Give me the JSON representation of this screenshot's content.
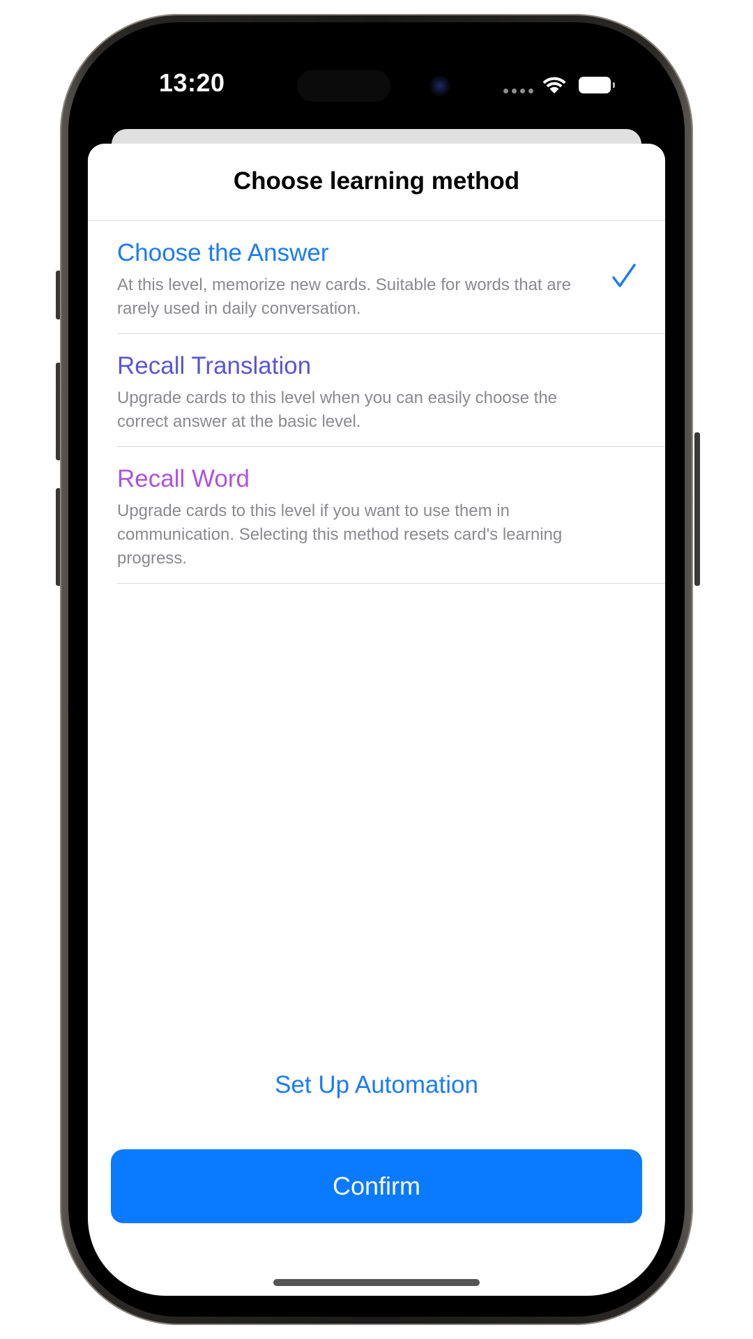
{
  "status_bar": {
    "time": "13:20",
    "icons": [
      "signal-dots-icon",
      "wifi-icon",
      "battery-icon"
    ]
  },
  "sheet": {
    "title": "Choose learning method"
  },
  "options": [
    {
      "title": "Choose the Answer",
      "description": "At this level, memorize new cards. Suitable for words that are rarely used in daily conversation.",
      "color": "#1a7cf5",
      "selected": true
    },
    {
      "title": "Recall Translation",
      "description": "Upgrade cards to this level when you can easily choose the correct answer at the basic level.",
      "color": "#5856d6",
      "selected": false
    },
    {
      "title": "Recall Word",
      "description": "Upgrade cards to this level if you want to use them in communication. Selecting this method resets card's learning progress.",
      "color": "#af52de",
      "selected": false
    }
  ],
  "actions": {
    "automation_label": "Set Up Automation",
    "confirm_label": "Confirm"
  },
  "colors": {
    "accent": "#0a7aff",
    "link": "#1a7cf5",
    "secondary_text": "#8a8a8e"
  }
}
